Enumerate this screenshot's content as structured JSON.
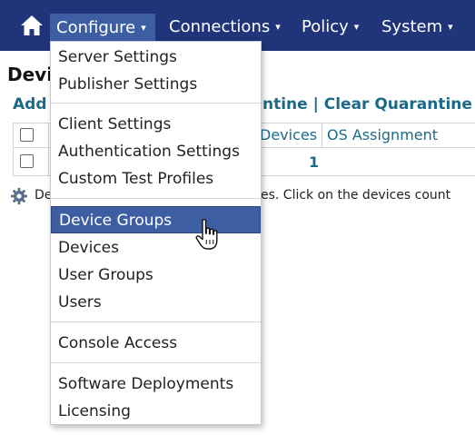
{
  "navbar": {
    "home_icon": "home-icon",
    "items": [
      {
        "label": "Configure",
        "active": true
      },
      {
        "label": "Connections"
      },
      {
        "label": "Policy"
      },
      {
        "label": "System"
      }
    ],
    "chevron": "⌄"
  },
  "background": {
    "title_fragment": "Devi",
    "link_add": "Add",
    "link_tail": "ntine | Clear Quarantine",
    "grid": {
      "headers": [
        "Devices",
        "OS Assignment"
      ],
      "rows": [
        {
          "devices": "1"
        }
      ]
    },
    "info_fragment_a": "De",
    "info_fragment_b": "es.   Click on the devices count"
  },
  "menu": {
    "items": [
      {
        "label": "Server Settings"
      },
      {
        "label": "Publisher Settings"
      },
      {
        "label": "Client Settings"
      },
      {
        "label": "Authentication Settings"
      },
      {
        "label": "Custom Test Profiles"
      },
      {
        "label": "Device Groups",
        "hovered": true
      },
      {
        "label": "Devices"
      },
      {
        "label": "User Groups"
      },
      {
        "label": "Users"
      },
      {
        "label": "Console Access"
      },
      {
        "label": "Software Deployments"
      },
      {
        "label": "Licensing"
      }
    ]
  },
  "colors": {
    "navbar_bg": "#20347a",
    "active_bg": "#3e5ea3",
    "link": "#1d6a88"
  }
}
